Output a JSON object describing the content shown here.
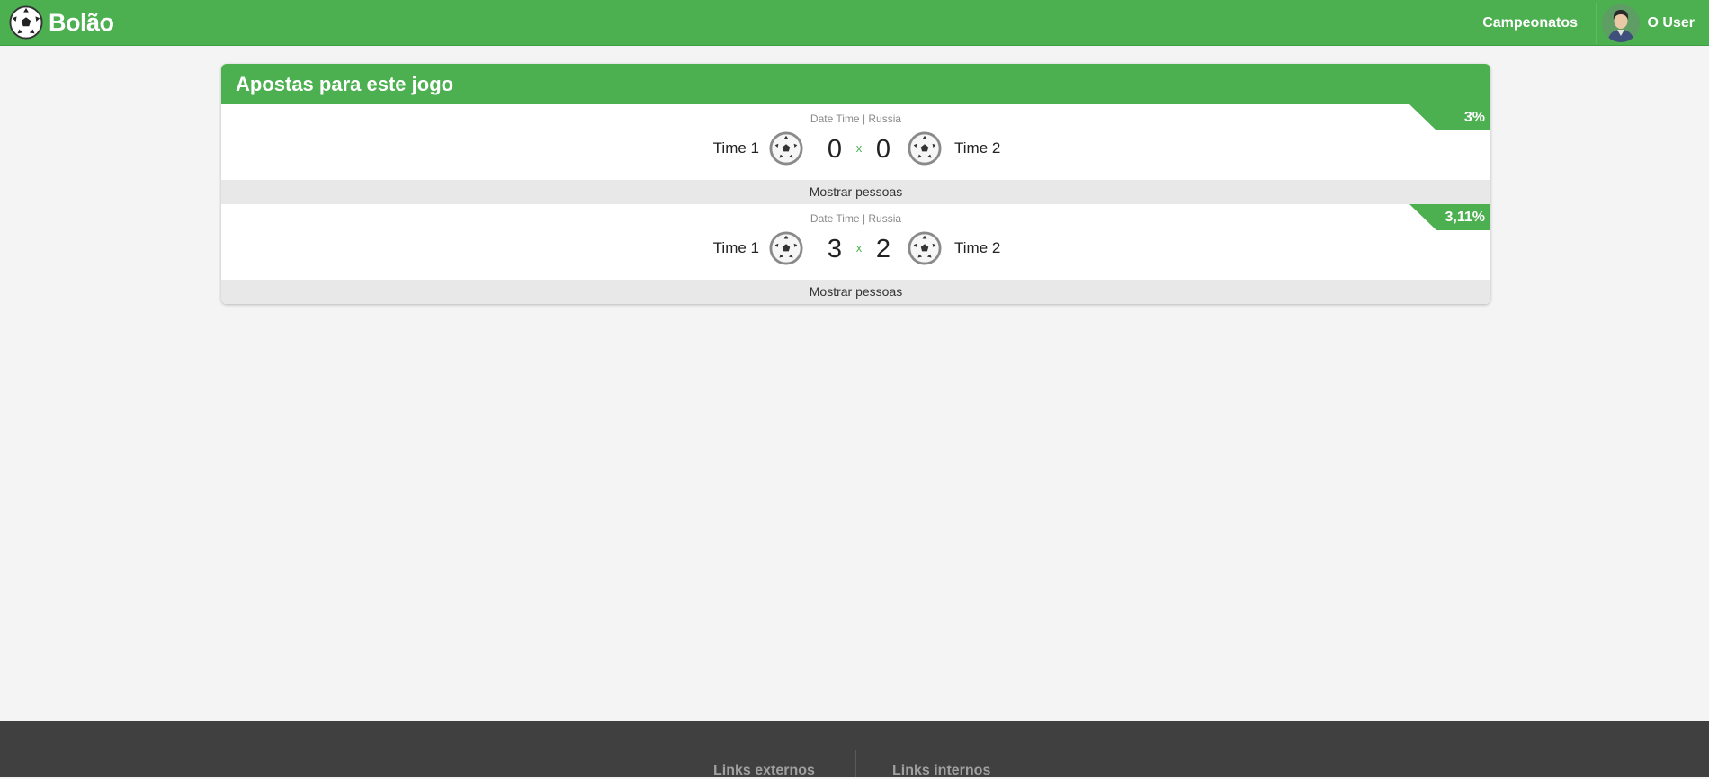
{
  "header": {
    "brand": "Bolão",
    "nav_championships": "Campeonatos",
    "user_name": "O User"
  },
  "card": {
    "title": "Apostas para este jogo",
    "bets": [
      {
        "meta": "Date Time | Russia",
        "team1": "Time 1",
        "team2": "Time 2",
        "score1": "0",
        "separator": "x",
        "score2": "0",
        "percent": "3%",
        "show_people": "Mostrar pessoas"
      },
      {
        "meta": "Date Time | Russia",
        "team1": "Time 1",
        "team2": "Time 2",
        "score1": "3",
        "separator": "x",
        "score2": "2",
        "percent": "3,11%",
        "show_people": "Mostrar pessoas"
      }
    ]
  },
  "footer": {
    "external_links": "Links externos",
    "internal_links": "Links internos"
  },
  "colors": {
    "accent": "#4caf50",
    "background": "#f4f4f4",
    "footer": "#404040"
  },
  "icons": {
    "brand": "soccer-ball-icon",
    "team": "soccer-ball-icon",
    "avatar": "user-avatar"
  }
}
